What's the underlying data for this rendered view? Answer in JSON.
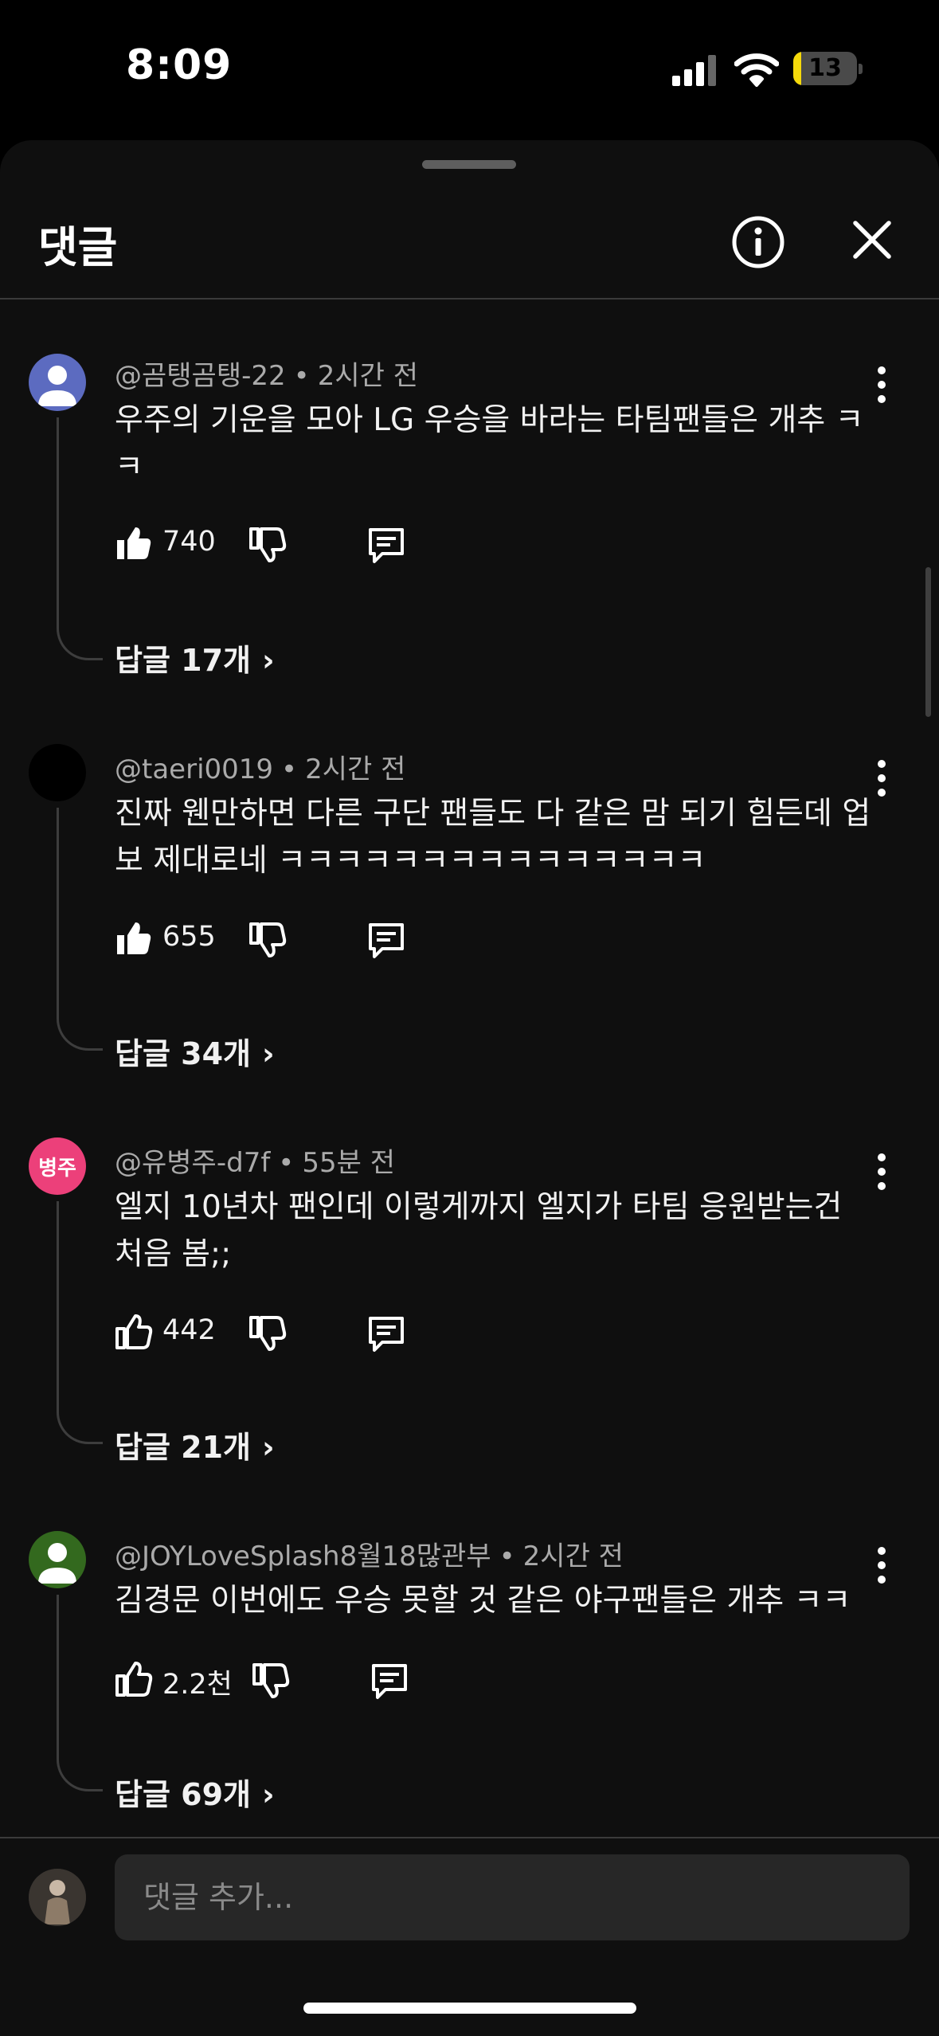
{
  "status_bar": {
    "time": "8:09",
    "battery": "13"
  },
  "header": {
    "title": "댓글",
    "info_icon": "info-icon",
    "close_icon": "close-icon"
  },
  "comments": [
    {
      "author": "@곰탱곰탱-22",
      "time": "2시간 전",
      "text": "우주의 기운을 모아 LG 우승을 바라는 타팀팬들은 개추 ㅋㅋ",
      "likes": "740",
      "liked": true,
      "replies": "답글 17개",
      "avatar_text": "",
      "avatar_color": "#5c6bc0"
    },
    {
      "author": "@taeri0019",
      "time": "2시간 전",
      "text": "진짜 웬만하면 다른 구단 팬들도 다 같은 맘 되기 힘든데 업보 제대로네 ㅋㅋㅋㅋㅋㅋㅋㅋㅋㅋㅋㅋㅋㅋㅋ",
      "likes": "655",
      "liked": true,
      "replies": "답글 34개",
      "avatar_text": "",
      "avatar_color": "#000000"
    },
    {
      "author": "@유병주-d7f",
      "time": "55분 전",
      "text": "엘지 10년차 팬인데 이렇게까지 엘지가 타팀 응원받는건 처음 봄;;",
      "likes": "442",
      "liked": false,
      "replies": "답글 21개",
      "avatar_text": "병주",
      "avatar_color": "#ec407a"
    },
    {
      "author": "@JOYLoveSplash8월18많관부",
      "time": "2시간 전",
      "text": "김경문 이번에도 우승 못할 것 같은 야구팬들은 개추 ㅋㅋ",
      "likes": "2.2천",
      "liked": false,
      "replies": "답글 69개",
      "avatar_text": "",
      "avatar_color": "#33691e"
    }
  ],
  "input": {
    "placeholder": "댓글 추가..."
  },
  "colors": {
    "sheet_bg": "#0f0f0f",
    "text": "#f1f1f1",
    "secondary": "#aaaaaa",
    "battery_fill": "#f5d90a"
  }
}
